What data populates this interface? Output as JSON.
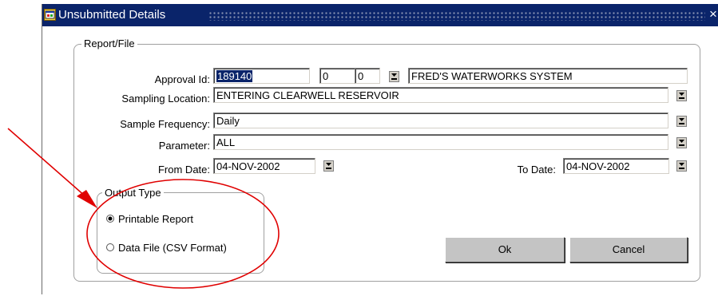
{
  "window": {
    "title": "Unsubmitted Details",
    "close_glyph": "×",
    "title_icon": "app-window-icon"
  },
  "report_file": {
    "legend": "Report/File",
    "approval_id_label": "Approval Id:",
    "approval_id_value": "189140",
    "approval_sub1": "0",
    "approval_sub2": "0",
    "system_name": "FRED'S WATERWORKS SYSTEM",
    "sampling_location_label": "Sampling Location:",
    "sampling_location_value": "ENTERING CLEARWELL RESERVOIR",
    "sample_frequency_label": "Sample Frequency:",
    "sample_frequency_value": "Daily",
    "parameter_label": "Parameter:",
    "parameter_value": "ALL",
    "from_date_label": "From Date:",
    "from_date_value": "04-NOV-2002",
    "to_date_label": "To Date:",
    "to_date_value": "04-NOV-2002"
  },
  "output_type": {
    "legend": "Output Type",
    "options": [
      {
        "label": "Printable Report",
        "selected": true
      },
      {
        "label": "Data File (CSV Format)",
        "selected": false
      }
    ]
  },
  "buttons": {
    "ok": "Ok",
    "cancel": "Cancel"
  },
  "annotation": {
    "arrow_color": "#e00000",
    "ellipse_color": "#e00000"
  }
}
